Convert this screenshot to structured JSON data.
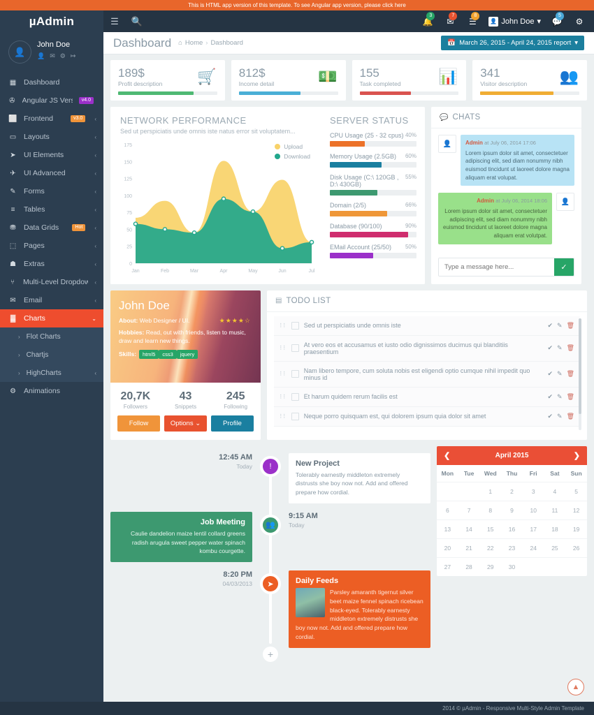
{
  "promo": {
    "text": "This is HTML app version of this template. To see Angular app version, please click here"
  },
  "navbar": {
    "brand": "µAdmin",
    "menu_icon": "hamburger-icon",
    "search_icon": "search-icon",
    "user_name": "John Doe",
    "badges": {
      "bell": "3",
      "mail": "7",
      "tasks": "8",
      "chat": "5"
    },
    "colors": {
      "bell": "#27a567",
      "mail": "#e8522f",
      "tasks": "#f0a22e",
      "chat": "#4aa8d8"
    }
  },
  "sidebar": {
    "profile": {
      "name": "John Doe"
    },
    "items": [
      {
        "label": "Dashboard",
        "icon": "dashboard-icon",
        "caret": false,
        "badge": null
      },
      {
        "label": "Angular JS Version",
        "icon": "megaphone-icon",
        "caret": false,
        "badge": "v4.0",
        "badge_color": "#9b30c9"
      },
      {
        "label": "Frontend",
        "icon": "laptop-icon",
        "caret": true,
        "badge": "v3.0",
        "badge_color": "#f0943a"
      },
      {
        "label": "Layouts",
        "icon": "monitor-icon",
        "caret": true,
        "badge": null
      },
      {
        "label": "UI Elements",
        "icon": "paper-plane-icon",
        "caret": true,
        "badge": null
      },
      {
        "label": "UI Advanced",
        "icon": "rocket-icon",
        "caret": true,
        "badge": null
      },
      {
        "label": "Forms",
        "icon": "edit-icon",
        "caret": true,
        "badge": null
      },
      {
        "label": "Tables",
        "icon": "table-icon",
        "caret": true,
        "badge": null
      },
      {
        "label": "Data Grids",
        "icon": "database-icon",
        "caret": true,
        "badge": "Hot",
        "badge_color": "#f0943a"
      },
      {
        "label": "Pages",
        "icon": "file-icon",
        "caret": true,
        "badge": null
      },
      {
        "label": "Extras",
        "icon": "gift-icon",
        "caret": true,
        "badge": null
      },
      {
        "label": "Multi-Level Dropdown",
        "icon": "sitemap-icon",
        "caret": true,
        "badge": null
      },
      {
        "label": "Email",
        "icon": "envelope-icon",
        "caret": true,
        "badge": null
      }
    ],
    "active_item": {
      "label": "Charts",
      "icon": "bar-chart-icon"
    },
    "submenu": [
      {
        "label": "Flot Charts",
        "caret": false
      },
      {
        "label": "Chartjs",
        "caret": false
      },
      {
        "label": "HighCharts",
        "caret": true
      }
    ],
    "last_item": {
      "label": "Animations",
      "icon": "cog-icon"
    },
    "active_color": "#ee4d2e"
  },
  "page_head": {
    "title": "Dashboard",
    "breadcrumb": [
      "Home",
      "Dashboard"
    ],
    "report_button": "March 26, 2015 - April 24, 2015 report"
  },
  "stats": [
    {
      "value": "189$",
      "desc": "Profit description",
      "icon": "shopping-cart-icon",
      "color": "#4fb973",
      "percent": 76
    },
    {
      "value": "812$",
      "desc": "Income detail",
      "icon": "money-icon",
      "color": "#4aafd6",
      "percent": 62
    },
    {
      "value": "155",
      "desc": "Task completed",
      "icon": "bar-chart-icon",
      "color": "#d9534f",
      "percent": 52
    },
    {
      "value": "341",
      "desc": "Visitor description",
      "icon": "users-icon",
      "color": "#f0ad33",
      "percent": 74
    }
  ],
  "chart_data": {
    "type": "area",
    "title": "NETWORK PERFORMANCE",
    "subtitle": "Sed ut perspiciatis unde omnis iste natus error sit voluptatem...",
    "categories": [
      "Jan",
      "Feb",
      "Mar",
      "Apr",
      "May",
      "Jun",
      "Jul"
    ],
    "series": [
      {
        "name": "Upload",
        "color": "#f8d269",
        "values": [
          67,
          92,
          45,
          151,
          76,
          123,
          31
        ]
      },
      {
        "name": "Download",
        "color": "#22a78c",
        "values": [
          58,
          50,
          45,
          95,
          76,
          22,
          31
        ]
      }
    ],
    "ylim": [
      0,
      175
    ],
    "yticks": [
      0,
      25,
      50,
      75,
      100,
      125,
      150,
      175
    ],
    "xlabel": "",
    "ylabel": "",
    "grid": false,
    "legend_position": "top-right"
  },
  "server_status": {
    "title": "SERVER STATUS",
    "rows": [
      {
        "label": "CPU Usage (25 - 32 cpus)",
        "pct": "40%",
        "value": 40,
        "color": "#ec7229"
      },
      {
        "label": "Memory Usage (2.5GB)",
        "pct": "60%",
        "value": 60,
        "color": "#1a7fa0"
      },
      {
        "label": "Disk Usage (C:\\ 120GB , D:\\ 430GB)",
        "pct": "55%",
        "value": 55,
        "color": "#3d9970"
      },
      {
        "label": "Domain (2/5)",
        "pct": "66%",
        "value": 66,
        "color": "#ef9738"
      },
      {
        "label": "Database (90/100)",
        "pct": "90%",
        "value": 90,
        "color": "#cf2d6e"
      },
      {
        "label": "EMail Account (25/50)",
        "pct": "50%",
        "value": 50,
        "color": "#9b30c9"
      }
    ]
  },
  "chats": {
    "title": "CHATS",
    "icon": "comments-icon",
    "messages": [
      {
        "who": "Admin",
        "when": "at July 06, 2014 17:06",
        "text": "Lorem ipsum dolor sit amet, consectetuer adipiscing elit, sed diam nonummy nibh euismod tincidunt ut laoreet dolore magna aliquam erat volupat.",
        "side": "left"
      },
      {
        "who": "Admin",
        "when": "at July 06, 2014 18:06",
        "text": "Lorem ipsum dolor sit amet, consectetuer adipiscing elit, sed diam nonummy nibh euismod tincidunt ut laoreet dolore magna aliquam erat volutpat.",
        "side": "right"
      }
    ],
    "input_placeholder": "Type a message here...",
    "send_icon": "check-icon"
  },
  "profile_card": {
    "name": "John Doe",
    "about_label": "About:",
    "about_value": "Web Designer / UI.",
    "hobbies_label": "Hobbies:",
    "hobbies_value": "Read, out with friends, listen to music, draw and learn new things.",
    "skills_label": "Skills:",
    "skills": [
      "html5",
      "css3",
      "jquery"
    ],
    "rating": "★★★★☆",
    "stats": [
      {
        "num": "20,7K",
        "label": "Followers"
      },
      {
        "num": "43",
        "label": "Snippets"
      },
      {
        "num": "245",
        "label": "Following"
      }
    ],
    "buttons": [
      {
        "label": "Follow",
        "color": "#f0943a"
      },
      {
        "label": "Options ⌄",
        "color": "#e8522f"
      },
      {
        "label": "Profile",
        "color": "#1a7fa0"
      }
    ]
  },
  "todo": {
    "title": "TODO LIST",
    "icon": "list-icon",
    "items": [
      "Sed ut perspiciatis unde omnis iste",
      "At vero eos et accusamus et iusto odio dignissimos ducimus qui blanditiis praesentium",
      "Nam libero tempore, cum soluta nobis est eligendi optio cumque nihil impedit quo minus id",
      "Et harum quidem rerum facilis est",
      "Neque porro quisquam est, qui dolorem ipsum quia dolor sit amet"
    ],
    "actions": {
      "done": "check-icon",
      "edit": "edit-icon",
      "delete": "trash-icon"
    }
  },
  "timeline": {
    "events": [
      {
        "time": "12:45 AM",
        "date": "Today",
        "side": "right",
        "dot_icon": "exclamation-icon",
        "dot_color": "#9b30c9",
        "title": "New Project",
        "text": "Tolerably earnestly middleton extremely distrusts she boy now not. Add and offered prepare how cordial.",
        "style": "white",
        "has_thumb": false
      },
      {
        "time": "9:15 AM",
        "date": "Today",
        "side": "left",
        "dot_icon": "users-icon",
        "dot_color": "#3d9970",
        "title": "Job Meeting",
        "text": "Caulie dandelion maize lentil collard greens radish arugula sweet pepper water spinach kombu courgette.",
        "style": "green",
        "has_thumb": false
      },
      {
        "time": "8:20 PM",
        "date": "04/03/2013",
        "side": "right",
        "dot_icon": "paper-plane-icon",
        "dot_color": "#ec5e24",
        "title": "Daily Feeds",
        "text": "Parsley amaranth tigernut silver beet maize fennel spinach ricebean black-eyed. Tolerably earnesty middleton extremely distrusts she boy now not. Add and offered prepare how cordial.",
        "style": "orange",
        "has_thumb": true
      }
    ],
    "add_icon": "plus-icon"
  },
  "calendar": {
    "title": "April 2015",
    "prev_icon": "chevron-left-icon",
    "next_icon": "chevron-right-icon",
    "dow": [
      "Mon",
      "Tue",
      "Wed",
      "Thu",
      "Fri",
      "Sat",
      "Sun"
    ],
    "cells": [
      "",
      "",
      "1",
      "2",
      "3",
      "4",
      "5",
      "6",
      "7",
      "8",
      "9",
      "10",
      "11",
      "12",
      "13",
      "14",
      "15",
      "16",
      "17",
      "18",
      "19",
      "20",
      "21",
      "22",
      "23",
      "24",
      "25",
      "26",
      "27",
      "28",
      "29",
      "30",
      "",
      "",
      ""
    ],
    "header_color": "#ea4f36"
  },
  "footer": {
    "text": "2014 © µAdmin - Responsive Multi-Style Admin Template"
  },
  "to_top": {
    "icon": "chevron-up-icon"
  }
}
